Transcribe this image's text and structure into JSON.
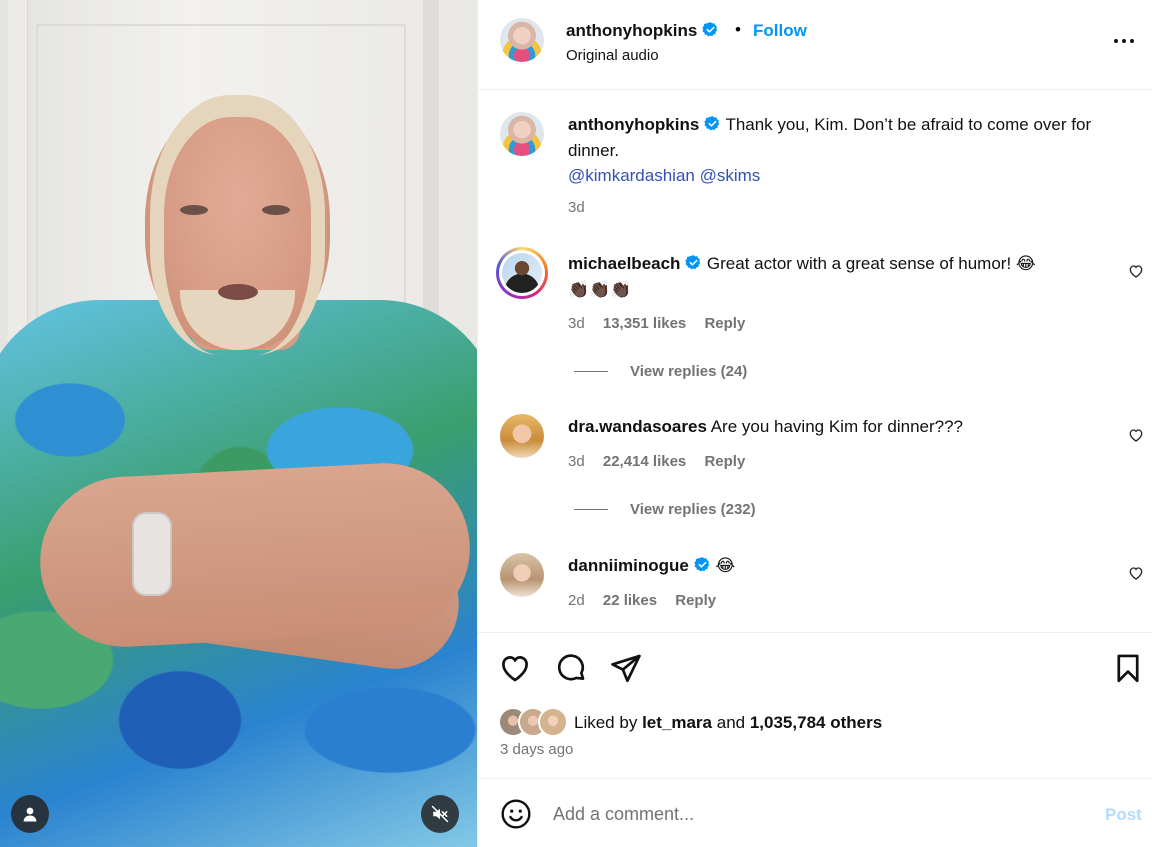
{
  "post": {
    "username": "anthonyhopkins",
    "follow_label": "Follow",
    "audio": "Original audio",
    "caption": {
      "username": "anthonyhopkins",
      "text": "Thank you, Kim. Don’t be afraid to come over for dinner.",
      "mentions": "@kimkardashian @skims",
      "time": "3d"
    }
  },
  "comments": [
    {
      "username": "michaelbeach",
      "verified": true,
      "text": "Great actor with a great sense of humor! 😂",
      "text2": "👏🏿👏🏿👏🏿",
      "time": "3d",
      "likes": "13,351 likes",
      "reply": "Reply",
      "view_replies": "View replies (24)"
    },
    {
      "username": "dra.wandasoares",
      "verified": false,
      "text": "Are you having Kim for dinner???",
      "time": "3d",
      "likes": "22,414 likes",
      "reply": "Reply",
      "view_replies": "View replies (232)"
    },
    {
      "username": "danniiminogue",
      "verified": true,
      "text": "😂",
      "time": "2d",
      "likes": "22 likes",
      "reply": "Reply"
    }
  ],
  "likes": {
    "prefix": "Liked by",
    "user": "let_mara",
    "and": "and",
    "others": "1,035,784 others"
  },
  "posted_ago": "3 days ago",
  "composer": {
    "placeholder": "Add a comment...",
    "post_label": "Post"
  },
  "colors": {
    "accent": "#0095f6",
    "mention": "#3451b2",
    "muted": "#737373",
    "post_disabled": "#b3dbff"
  }
}
